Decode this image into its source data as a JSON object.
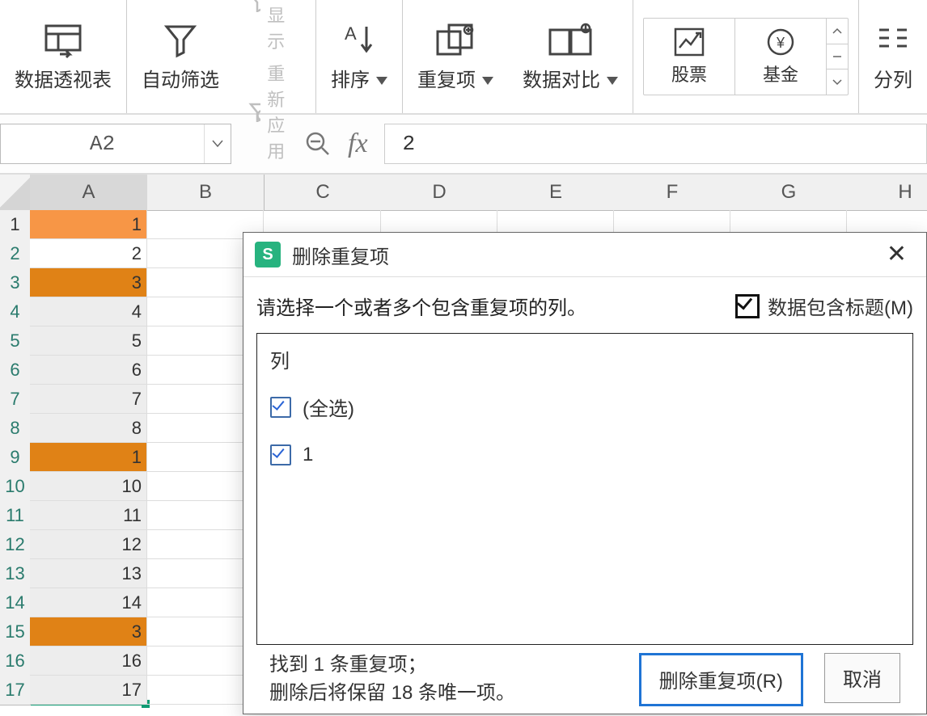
{
  "ribbon": {
    "pivot": "数据透视表",
    "autofilter": "自动筛选",
    "show_all": "全部显示",
    "reapply": "重新应用",
    "sort": "排序",
    "duplicates": "重复项",
    "datacompare": "数据对比",
    "stock": "股票",
    "fund": "基金",
    "textsplit": "分列"
  },
  "formula": {
    "namebox": "A2",
    "fx_value": "2"
  },
  "columns": [
    "A",
    "B",
    "C",
    "D",
    "E",
    "F",
    "G",
    "H"
  ],
  "rows": [
    {
      "n": "1",
      "v": "1",
      "cls": "hl1"
    },
    {
      "n": "2",
      "v": "2",
      "cls": "active"
    },
    {
      "n": "3",
      "v": "3",
      "cls": "hl2"
    },
    {
      "n": "4",
      "v": "4",
      "cls": "graysel"
    },
    {
      "n": "5",
      "v": "5",
      "cls": "graysel"
    },
    {
      "n": "6",
      "v": "6",
      "cls": "graysel"
    },
    {
      "n": "7",
      "v": "7",
      "cls": "graysel"
    },
    {
      "n": "8",
      "v": "8",
      "cls": "graysel"
    },
    {
      "n": "9",
      "v": "1",
      "cls": "hl2"
    },
    {
      "n": "10",
      "v": "10",
      "cls": "graysel"
    },
    {
      "n": "11",
      "v": "11",
      "cls": "graysel"
    },
    {
      "n": "12",
      "v": "12",
      "cls": "graysel"
    },
    {
      "n": "13",
      "v": "13",
      "cls": "graysel"
    },
    {
      "n": "14",
      "v": "14",
      "cls": "graysel"
    },
    {
      "n": "15",
      "v": "3",
      "cls": "hl2"
    },
    {
      "n": "16",
      "v": "16",
      "cls": "graysel"
    },
    {
      "n": "17",
      "v": "17",
      "cls": "graysel"
    }
  ],
  "dialog": {
    "title": "删除重复项",
    "prompt": "请选择一个或者多个包含重复项的列。",
    "has_header_label": "数据包含标题(M)",
    "col_header": "列",
    "select_all": "(全选)",
    "item1": "1",
    "found_line": "找到 1 条重复项；",
    "keep_line": "删除后将保留 18 条唯一项。",
    "btn_remove": "删除重复项(R)",
    "btn_cancel": "取消",
    "logo": "S"
  }
}
